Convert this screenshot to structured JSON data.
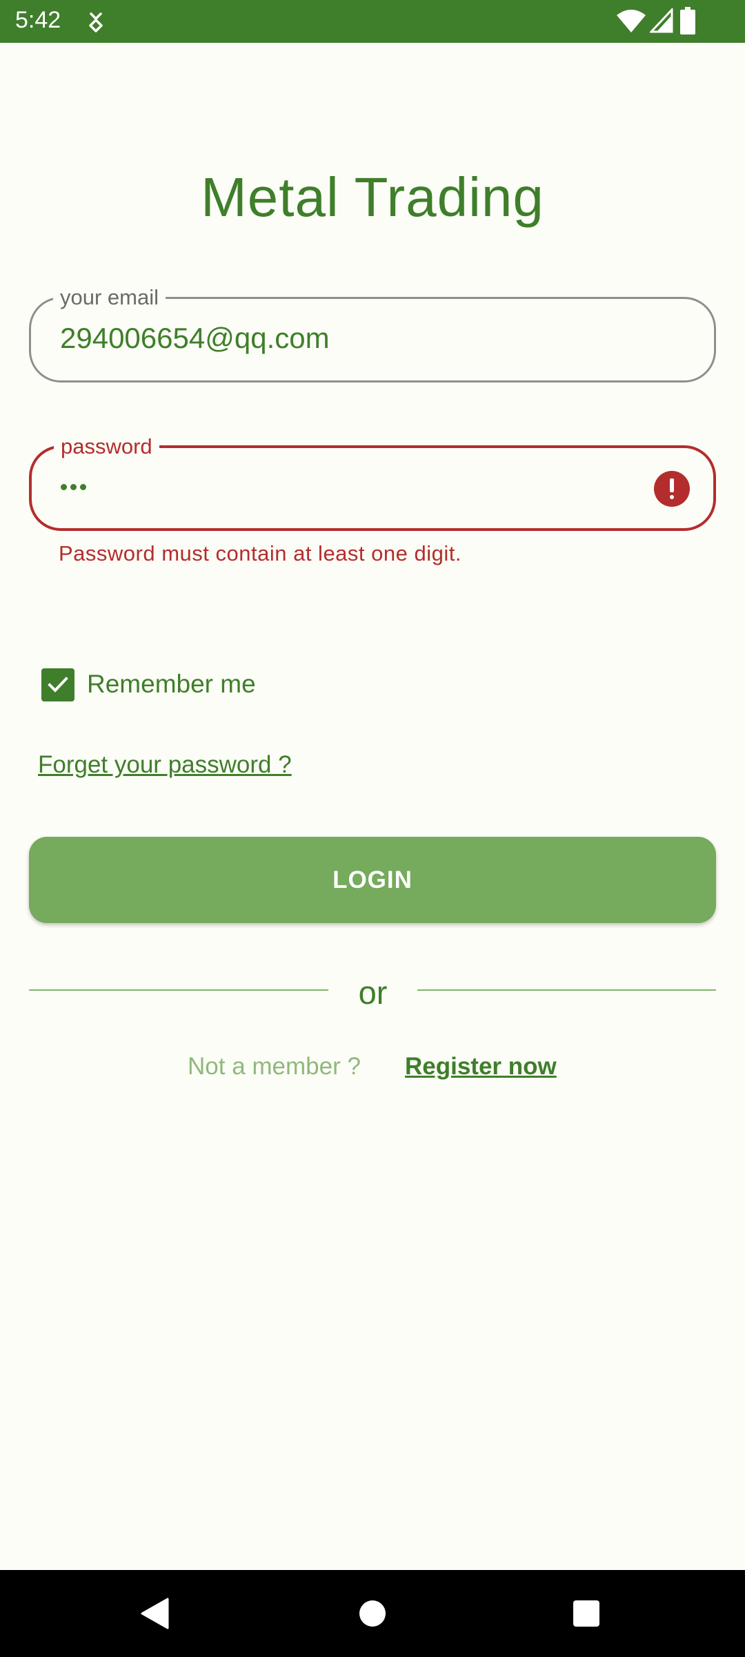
{
  "status_bar": {
    "time": "5:42",
    "icons": [
      "notification-icon",
      "wifi-icon",
      "signal-icon",
      "battery-icon"
    ]
  },
  "app": {
    "title": "Metal Trading"
  },
  "email": {
    "label": "your email",
    "value": "294006654@qq.com"
  },
  "password": {
    "label": "password",
    "masked_length": 3,
    "error": "Password must contain at least one digit."
  },
  "remember": {
    "label": "Remember me",
    "checked": true
  },
  "forgot_link": "Forget your password ?",
  "login_button": "LOGIN",
  "divider_text": "or",
  "register": {
    "prompt": "Not a member ?",
    "link": "Register now"
  },
  "nav_bar": {
    "icons": [
      "back-icon",
      "home-icon",
      "recents-icon"
    ]
  },
  "colors": {
    "primary": "#3F7E2B",
    "button": "#76AA5C",
    "error": "#B32D2D",
    "background": "#FCFDF6"
  }
}
